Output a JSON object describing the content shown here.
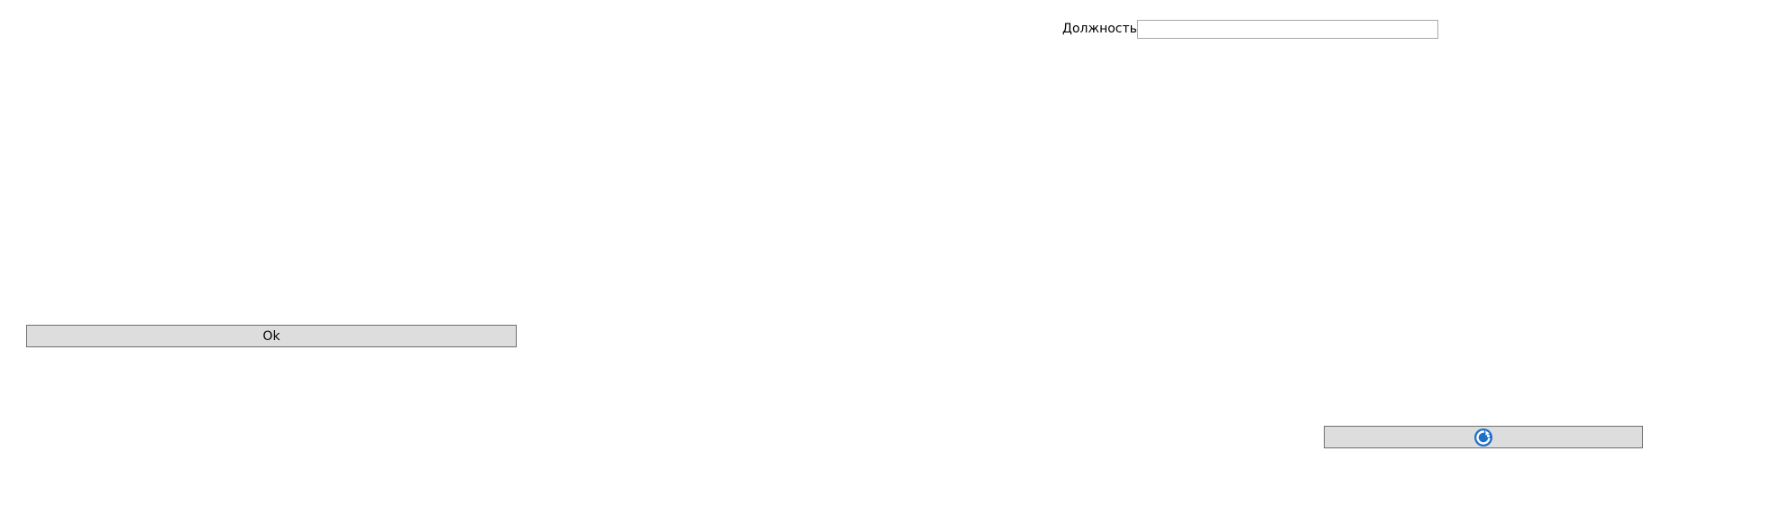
{
  "form": {
    "position_label": "Должность",
    "position_value": "",
    "position_placeholder": ""
  },
  "buttons": {
    "ok_label": "Ok",
    "refresh_icon": "refresh-icon"
  },
  "colors": {
    "button_bg": "#dddddd",
    "button_border": "#6f6f6f",
    "input_border": "#a9a9a9",
    "icon_blue": "#1e6fc7"
  }
}
